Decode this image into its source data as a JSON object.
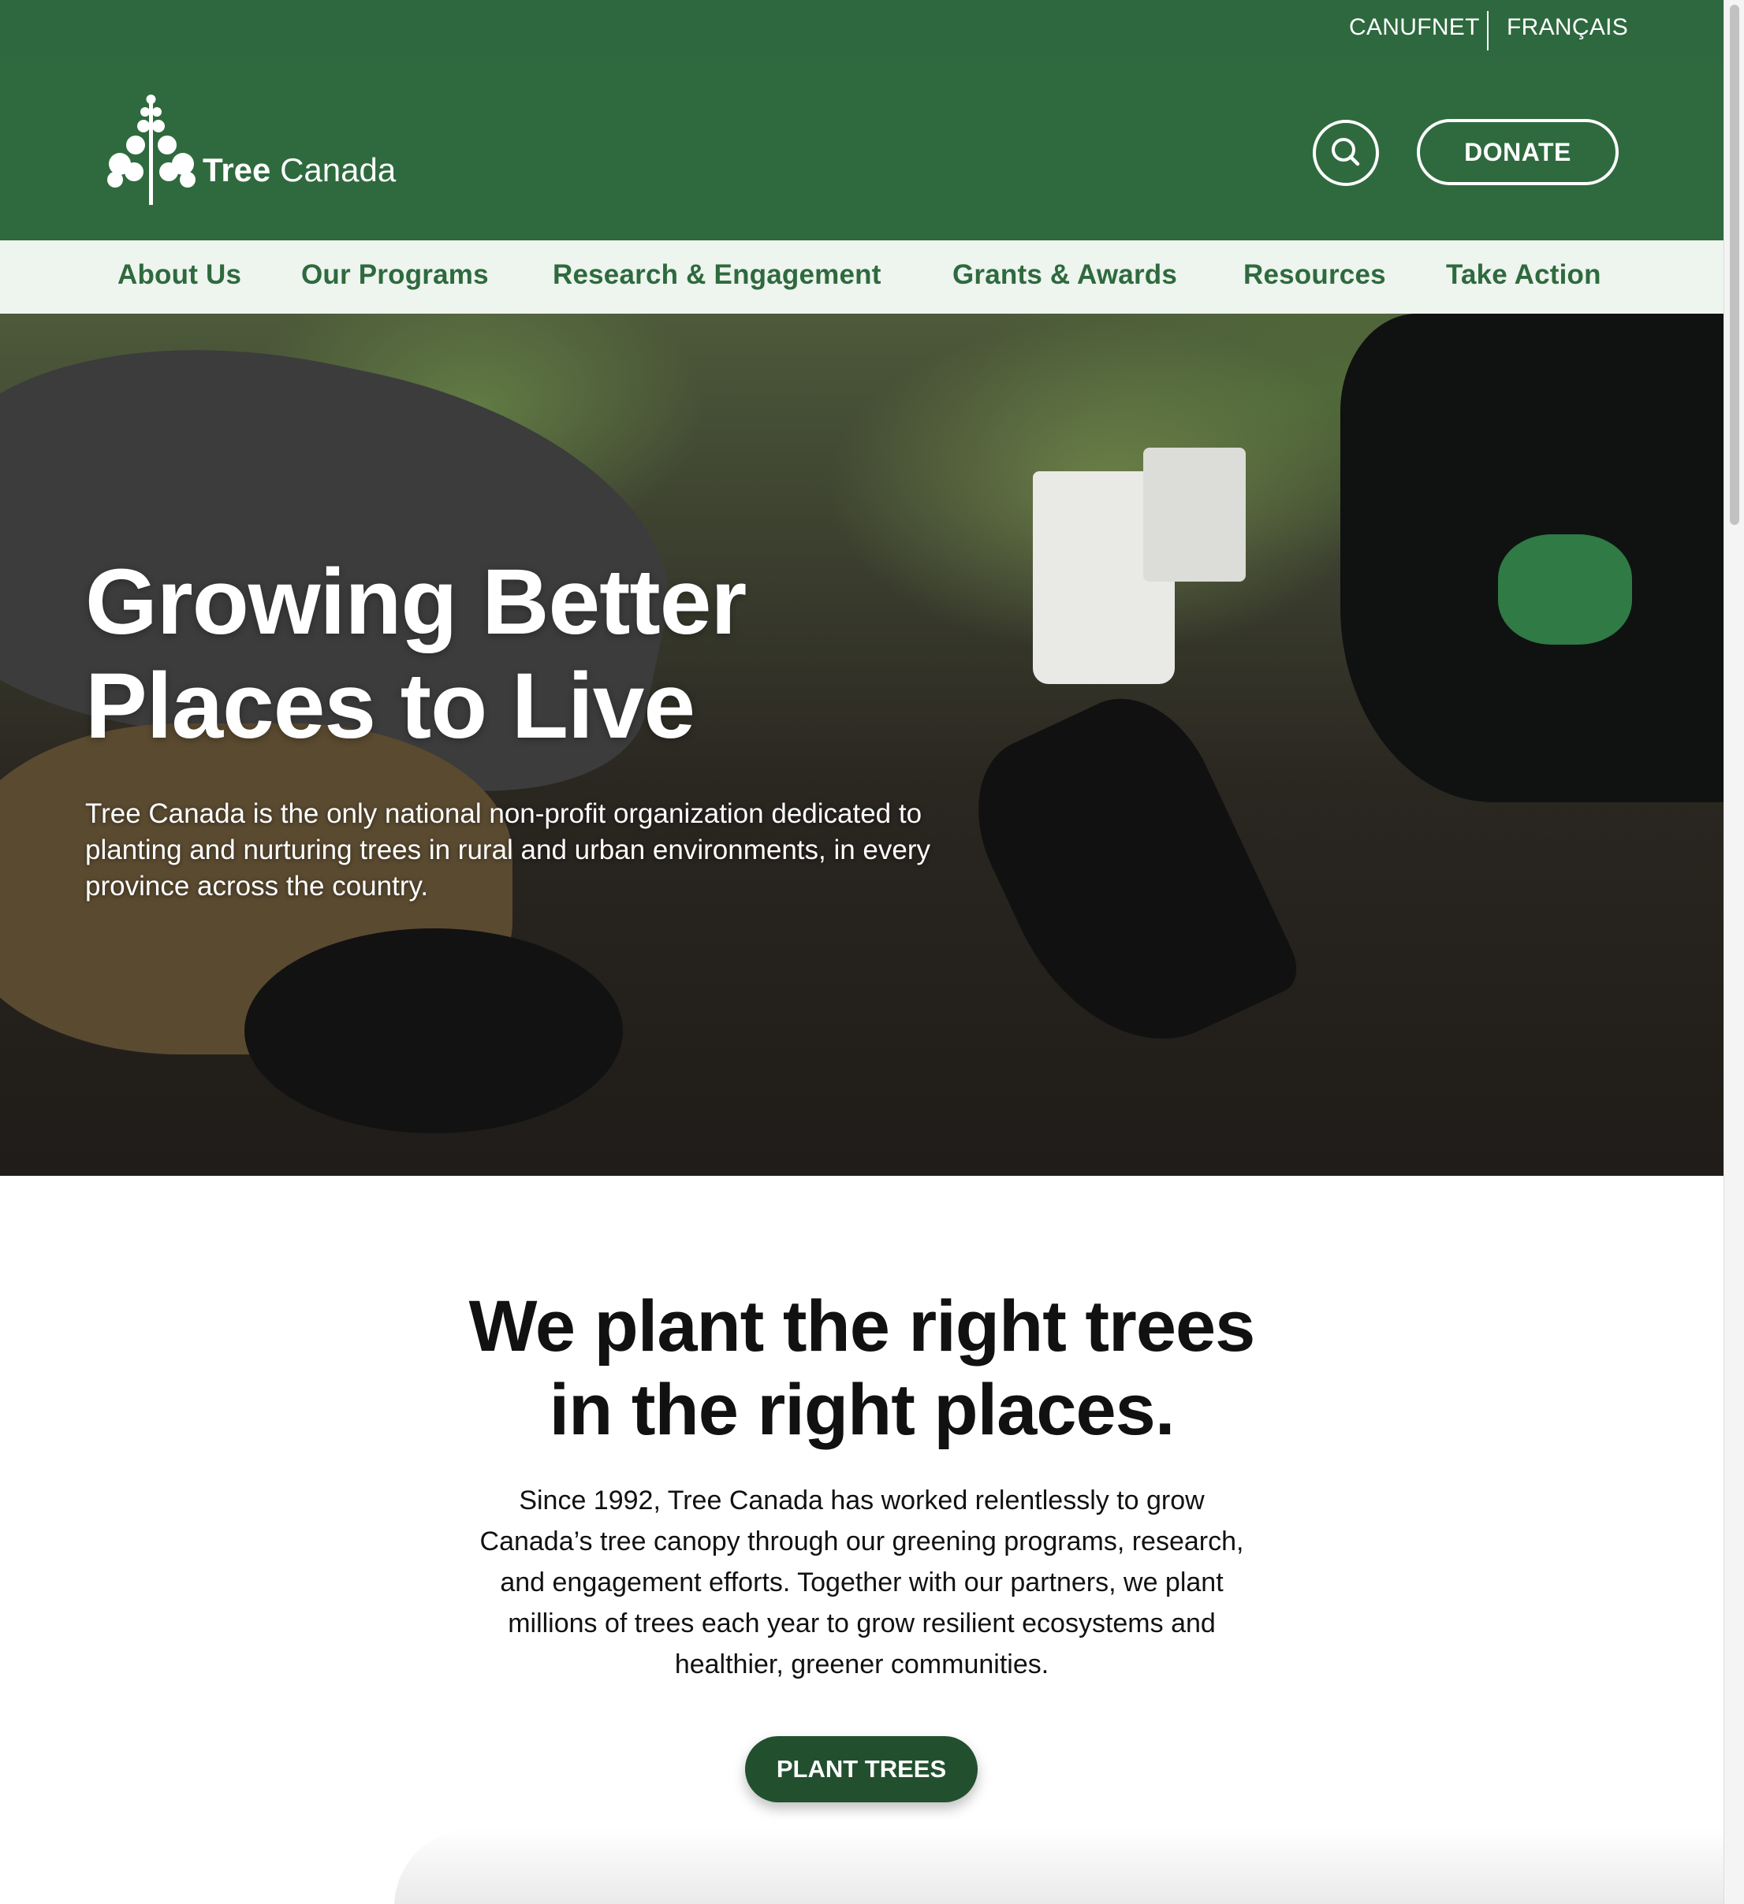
{
  "utility_nav": {
    "canufnet": "CANUFNET",
    "language": "FRANÇAIS"
  },
  "header": {
    "logo_text_bold": "Tree",
    "logo_text": "Canada",
    "search_icon": "search-icon",
    "donate_label": "DONATE"
  },
  "nav": {
    "items": [
      {
        "label": "About Us"
      },
      {
        "label": "Our Programs"
      },
      {
        "label": "Research & Engagement"
      },
      {
        "label": "Grants & Awards"
      },
      {
        "label": "Resources"
      },
      {
        "label": "Take Action"
      }
    ]
  },
  "hero": {
    "title_line1": "Growing Better",
    "title_line2": "Places to Live",
    "text": "Tree Canada is the only national non-profit organization dedicated to planting and nurturing trees in rural and urban environments, in every province across the country."
  },
  "intro": {
    "title_line1": "We plant the right trees",
    "title_line2": "in the right places.",
    "text": "Since 1992, Tree Canada has worked relentlessly to grow Canada’s tree canopy through our greening programs, research, and engagement efforts. Together with our partners, we plant millions of trees each year to grow resilient ecosystems and healthier, greener communities.",
    "cta_label": "PLANT TREES"
  },
  "colors": {
    "brand_green": "#2e6a3e",
    "nav_bg": "#eef4ee",
    "cta_green": "#22502f"
  }
}
